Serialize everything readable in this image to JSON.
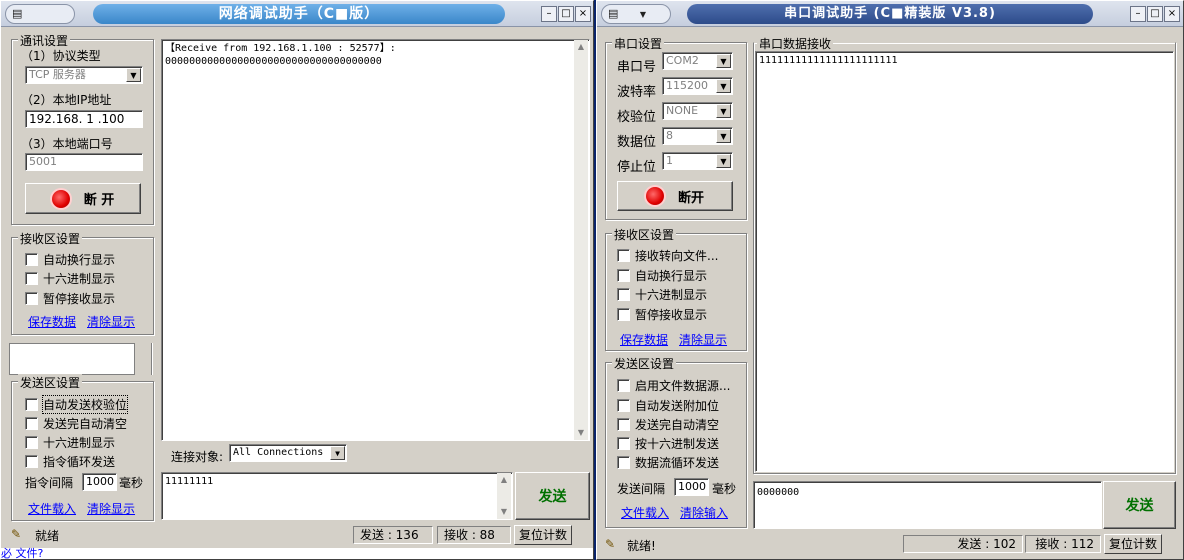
{
  "left": {
    "title": "网络调试助手（C■版）",
    "comm_group": "通讯设置",
    "protocol_label": "（1）协议类型",
    "protocol_value": "TCP 服务器",
    "ip_label": "（2）本地IP地址",
    "ip_value": "192.168. 1 .100",
    "port_label": "（3）本地端口号",
    "port_value": "5001",
    "disconnect_label": "断 开",
    "recv_group": "接收区设置",
    "recv_options": [
      "自动换行显示",
      "十六进制显示",
      "暂停接收显示"
    ],
    "save_data": "保存数据",
    "clear_display": "清除显示",
    "send_group": "发送区设置",
    "send_options": [
      "自动发送校验位",
      "发送完自动清空",
      "十六进制显示",
      "指令循环发送"
    ],
    "interval_label": "指令间隔",
    "interval_value": "1000",
    "interval_unit": "毫秒",
    "file_load": "文件载入",
    "clear_display2": "清除显示",
    "receive_text": "【Receive from 192.168.1.100 : 52577】:\n000000000000000000000000000000000000",
    "connect_label": "连接对象:",
    "connect_value": "All Connections",
    "send_text": "11111111",
    "send_button": "发送",
    "status_ready": "就绪",
    "sent_label": "发送 : 136",
    "recv_label": "接收 : 88",
    "reset_button": "复位计数",
    "bottom_snippet1": "必 文件?"
  },
  "right": {
    "title": "串口调试助手 (C■精装版 V3.8)",
    "sys_menu": "▼",
    "serial_group": "串口设置",
    "port_label": "串口号",
    "port_value": "COM2",
    "baud_label": "波特率",
    "baud_value": "115200",
    "parity_label": "校验位",
    "parity_value": "NONE",
    "databits_label": "数据位",
    "databits_value": "8",
    "stopbits_label": "停止位",
    "stopbits_value": "1",
    "disconnect_label": "断开",
    "recv_group": "接收区设置",
    "recv_options": [
      "接收转向文件...",
      "自动换行显示",
      "十六进制显示",
      "暂停接收显示"
    ],
    "save_data": "保存数据",
    "clear_display": "清除显示",
    "send_group": "发送区设置",
    "send_options": [
      "启用文件数据源...",
      "自动发送附加位",
      "发送完自动清空",
      "按十六进制发送",
      "数据流循环发送"
    ],
    "interval_label": "发送间隔",
    "interval_value": "1000",
    "interval_unit": "毫秒",
    "file_load": "文件载入",
    "clear_input": "清除输入",
    "recv_area_label": "串口数据接收",
    "receive_text": "11111111111111111111111",
    "send_text": "0000000",
    "send_button": "发送",
    "status_ready": "就绪!",
    "sent_label": "发送 : 102",
    "recv_label": "接收 : 112",
    "reset_button": "复位计数"
  },
  "colors": {
    "title_left": "#3a87c9",
    "title_right": "#2d4b8a",
    "link": "#0000ff",
    "send_green": "#007000"
  }
}
